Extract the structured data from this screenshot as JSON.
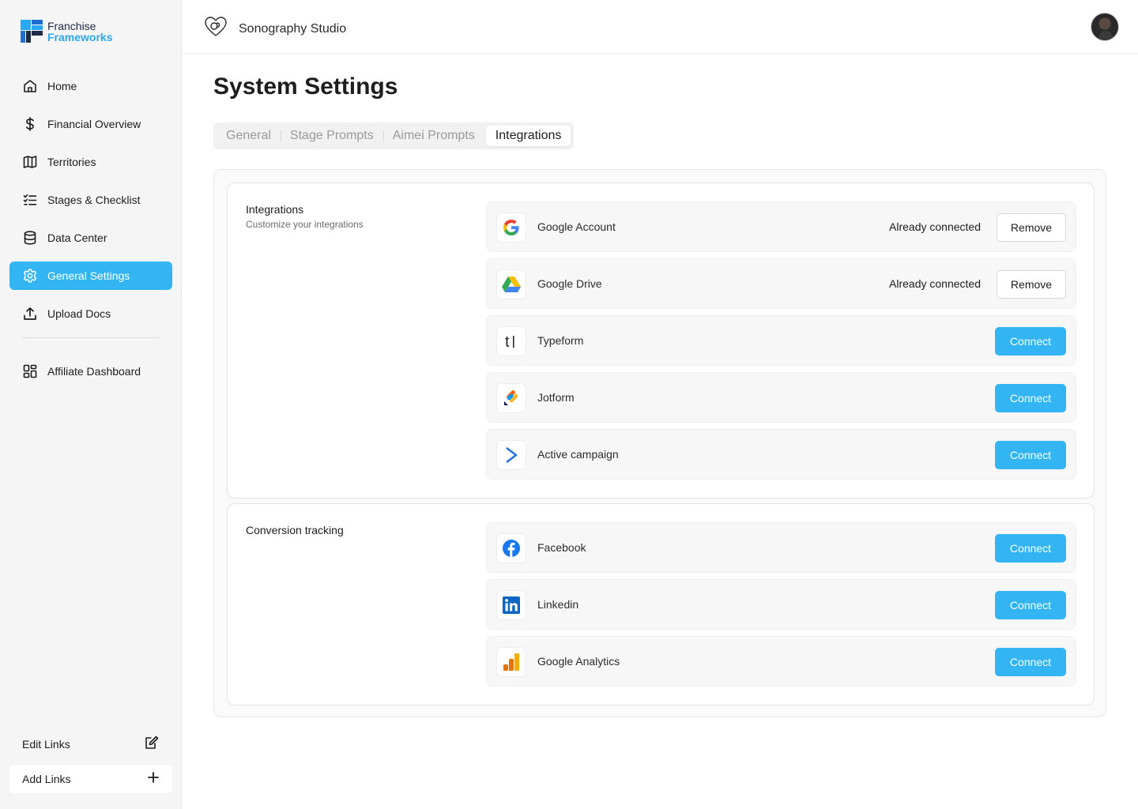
{
  "brand": {
    "line1": "Franchise",
    "line2": "Frameworks"
  },
  "colors": {
    "accent": "#33b5f4",
    "brand_dark": "#1f2a44"
  },
  "sidebar": {
    "items": [
      {
        "label": "Home",
        "icon": "home-icon"
      },
      {
        "label": "Financial Overview",
        "icon": "dollar-icon"
      },
      {
        "label": "Territories",
        "icon": "map-icon"
      },
      {
        "label": "Stages & Checklist",
        "icon": "checklist-icon"
      },
      {
        "label": "Data Center",
        "icon": "database-icon"
      },
      {
        "label": "General Settings",
        "icon": "gear-icon",
        "active": true
      },
      {
        "label": "Upload Docs",
        "icon": "upload-icon"
      }
    ],
    "secondary": [
      {
        "label": "Affiliate Dashboard",
        "icon": "dashboard-icon"
      }
    ],
    "edit_links": "Edit Links",
    "add_links": "Add Links"
  },
  "header": {
    "studio_name": "Sonography Studio"
  },
  "page": {
    "title": "System Settings",
    "tabs": [
      {
        "label": "General"
      },
      {
        "label": "Stage Prompts"
      },
      {
        "label": "Aimei Prompts"
      },
      {
        "label": "Integrations",
        "active": true
      }
    ]
  },
  "integrations": {
    "title": "Integrations",
    "subtitle": "Customize your integrations",
    "items": [
      {
        "name": "Google Account",
        "icon": "google-icon",
        "status": "Already connected",
        "action": "Remove"
      },
      {
        "name": "Google Drive",
        "icon": "google-drive-icon",
        "status": "Already connected",
        "action": "Remove"
      },
      {
        "name": "Typeform",
        "icon": "typeform-icon",
        "action": "Connect"
      },
      {
        "name": "Jotform",
        "icon": "jotform-icon",
        "action": "Connect"
      },
      {
        "name": "Active campaign",
        "icon": "activecampaign-icon",
        "action": "Connect"
      }
    ]
  },
  "conversion": {
    "title": "Conversion tracking",
    "items": [
      {
        "name": "Facebook",
        "icon": "facebook-icon",
        "action": "Connect"
      },
      {
        "name": "Linkedin",
        "icon": "linkedin-icon",
        "action": "Connect"
      },
      {
        "name": "Google Analytics",
        "icon": "google-analytics-icon",
        "action": "Connect"
      }
    ]
  }
}
